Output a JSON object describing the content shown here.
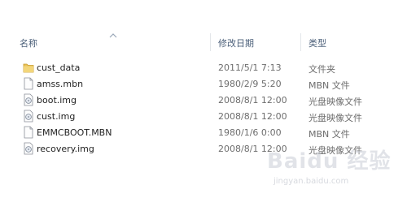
{
  "columns": {
    "name": "名称",
    "date": "修改日期",
    "type": "类型"
  },
  "files": [
    {
      "name": "cust_data",
      "date": "2011/5/1 7:13",
      "type": "文件夹",
      "icon": "folder-icon"
    },
    {
      "name": "amss.mbn",
      "date": "1980/2/9 5:20",
      "type": "MBN 文件",
      "icon": "file-icon"
    },
    {
      "name": "boot.img",
      "date": "2008/8/1 12:00",
      "type": "光盘映像文件",
      "icon": "disc-image-icon"
    },
    {
      "name": "cust.img",
      "date": "2008/8/1 12:00",
      "type": "光盘映像文件",
      "icon": "disc-image-icon"
    },
    {
      "name": "EMMCBOOT.MBN",
      "date": "1980/1/6 0:00",
      "type": "MBN 文件",
      "icon": "file-icon"
    },
    {
      "name": "recovery.img",
      "date": "2008/8/1 12:00",
      "type": "光盘映像文件",
      "icon": "disc-image-icon"
    }
  ],
  "watermark": {
    "logo": "Baidu 经验",
    "url": "jingyan.baidu.com"
  },
  "colors": {
    "header_text": "#4c607a",
    "folder": "#e8c25a",
    "meta_text": "#6d6d6d"
  }
}
